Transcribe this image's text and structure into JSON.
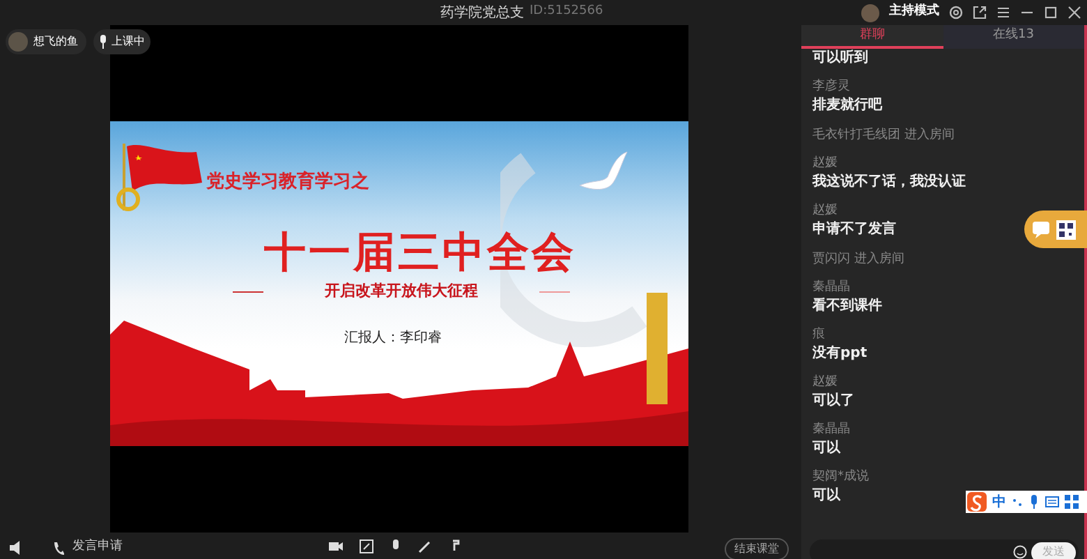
{
  "window": {
    "title": "药学院党总支",
    "id": "ID:5152566",
    "mode": "主持模式"
  },
  "presenter": {
    "name": "想飞的鱼"
  },
  "status": {
    "label": "上课中"
  },
  "slide": {
    "subtitle": "党史学习教育学习之",
    "title": "十一届三中全会",
    "tagline": "开启改革开放伟大征程",
    "reporter": "汇报人：李印睿"
  },
  "bottom_bar": {
    "request": "发言申请",
    "end_button": "结束课堂"
  },
  "chat": {
    "tabs": [
      {
        "label": "群聊",
        "selected": true
      },
      {
        "label": "在线13",
        "selected": false
      }
    ],
    "messages": [
      {
        "kind": "message",
        "text": "可以听到"
      },
      {
        "kind": "message",
        "sender": "李彦灵",
        "text": "排麦就行吧"
      },
      {
        "kind": "system",
        "text": "毛衣针打毛线团 进入房间"
      },
      {
        "kind": "message",
        "sender": "赵媛",
        "text": "我这说不了话，我没认证"
      },
      {
        "kind": "message",
        "sender": "赵媛",
        "text": "申请不了发言"
      },
      {
        "kind": "system",
        "text": "贾闪闪 进入房间"
      },
      {
        "kind": "message",
        "sender": "秦晶晶",
        "text": "看不到课件"
      },
      {
        "kind": "message",
        "sender": "痕",
        "text": "没有ppt"
      },
      {
        "kind": "message",
        "sender": "赵媛",
        "text": "可以了"
      },
      {
        "kind": "message",
        "sender": "秦晶晶",
        "text": "可以"
      },
      {
        "kind": "message",
        "sender": "契阔*成说",
        "text": "可以"
      }
    ],
    "send_button": "发送"
  },
  "ime_bar": {
    "label": "中"
  }
}
